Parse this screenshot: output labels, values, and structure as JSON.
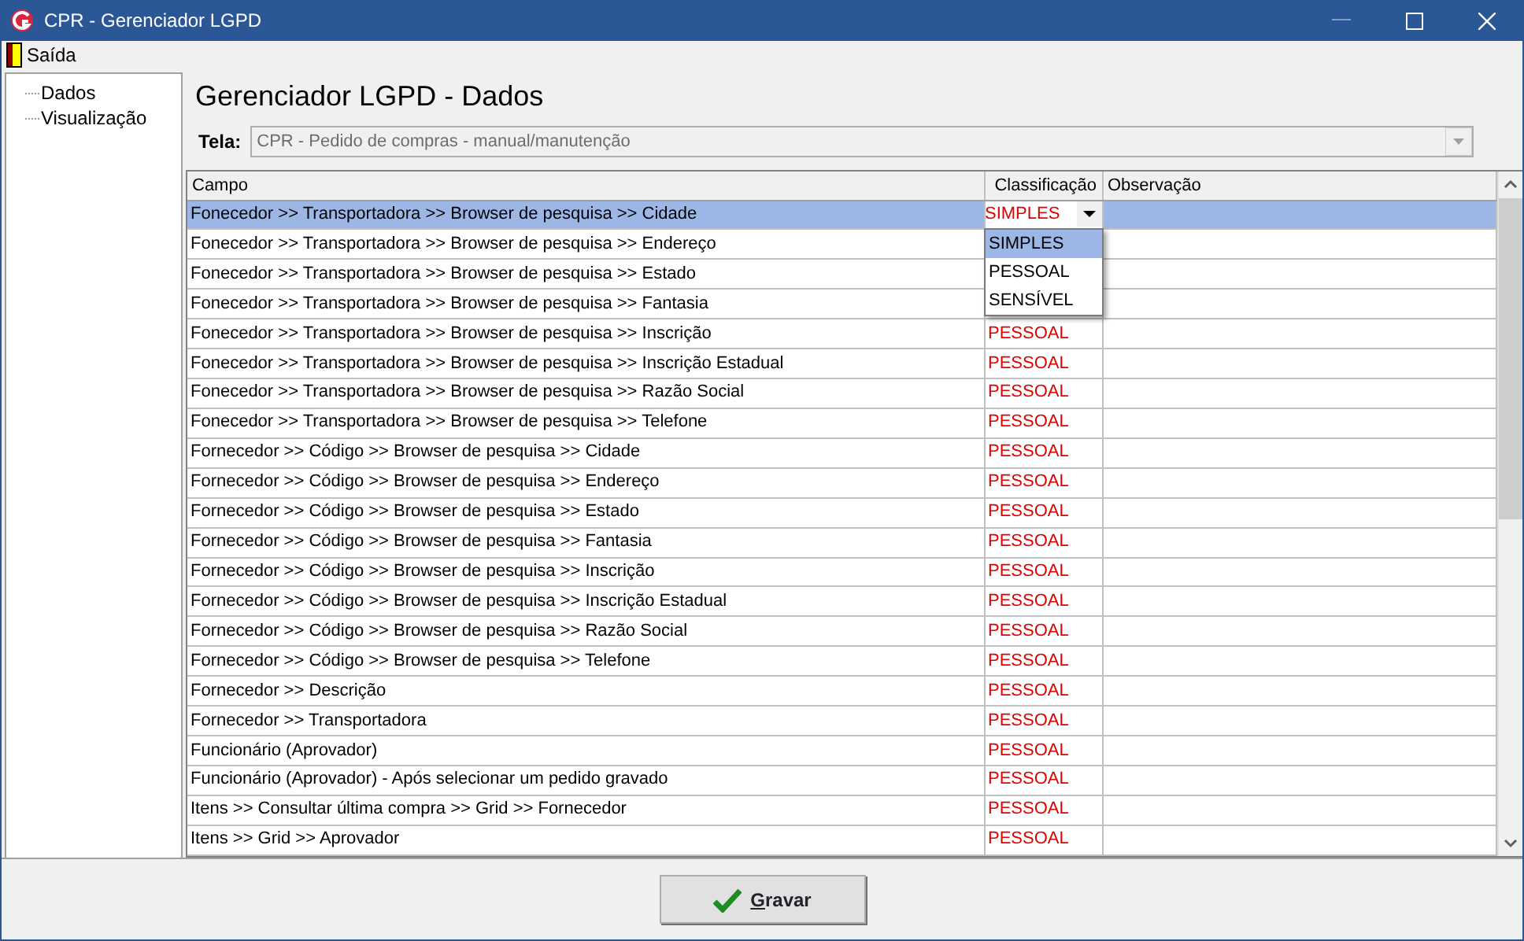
{
  "window": {
    "title": "CPR - Gerenciador LGPD"
  },
  "menu": [
    {
      "label": "Saída"
    }
  ],
  "tree": {
    "items": [
      {
        "label": "Dados",
        "selected": false
      },
      {
        "label": "Visualização",
        "selected": false
      }
    ]
  },
  "heading": "Gerenciador LGPD - Dados",
  "screen_field": {
    "label": "Tela:",
    "value": "CPR - Pedido de compras - manual/manutenção",
    "disabled": true
  },
  "table": {
    "columns": [
      "Campo",
      "Classificação",
      "Observação"
    ],
    "rows": [
      {
        "campo": "Fonecedor >> Transportadora >> Browser de pesquisa >> Cidade",
        "classificacao": "SIMPLES",
        "selected": true,
        "editing": true
      },
      {
        "campo": "Fonecedor >> Transportadora >> Browser de pesquisa >> Endereço",
        "selected": false
      },
      {
        "campo": "Fonecedor >> Transportadora >> Browser de pesquisa >> Estado",
        "selected": false
      },
      {
        "campo": "Fonecedor >> Transportadora >> Browser de pesquisa >> Fantasia",
        "selected": false
      },
      {
        "campo": "Fonecedor >> Transportadora >> Browser de pesquisa >> Inscrição",
        "classificacao": "PESSOAL",
        "selected": false
      },
      {
        "campo": "Fonecedor >> Transportadora >> Browser de pesquisa >> Inscrição Estadual",
        "classificacao": "PESSOAL",
        "selected": false
      },
      {
        "campo": "Fonecedor >> Transportadora >> Browser de pesquisa >> Razão Social",
        "classificacao": "PESSOAL",
        "selected": false
      },
      {
        "campo": "Fonecedor >> Transportadora >> Browser de pesquisa >> Telefone",
        "classificacao": "PESSOAL",
        "selected": false
      },
      {
        "campo": "Fornecedor >> Código >> Browser de pesquisa >> Cidade",
        "classificacao": "PESSOAL",
        "selected": false
      },
      {
        "campo": "Fornecedor >> Código >> Browser de pesquisa >> Endereço",
        "classificacao": "PESSOAL",
        "selected": false
      },
      {
        "campo": "Fornecedor >> Código >> Browser de pesquisa >> Estado",
        "classificacao": "PESSOAL",
        "selected": false
      },
      {
        "campo": "Fornecedor >> Código >> Browser de pesquisa >> Fantasia",
        "classificacao": "PESSOAL",
        "selected": false
      },
      {
        "campo": "Fornecedor >> Código >> Browser de pesquisa >> Inscrição",
        "classificacao": "PESSOAL",
        "selected": false
      },
      {
        "campo": "Fornecedor >> Código >> Browser de pesquisa >> Inscrição Estadual",
        "classificacao": "PESSOAL",
        "selected": false
      },
      {
        "campo": "Fornecedor >> Código >> Browser de pesquisa >> Razão Social",
        "classificacao": "PESSOAL",
        "selected": false
      },
      {
        "campo": "Fornecedor >> Código >> Browser de pesquisa >> Telefone",
        "classificacao": "PESSOAL",
        "selected": false
      },
      {
        "campo": "Fornecedor >> Descrição",
        "classificacao": "PESSOAL",
        "selected": false
      },
      {
        "campo": "Fornecedor >> Transportadora",
        "classificacao": "PESSOAL",
        "selected": false
      },
      {
        "campo": "Funcionário (Aprovador)",
        "classificacao": "PESSOAL",
        "selected": false
      },
      {
        "campo": "Funcionário (Aprovador) -  Após selecionar um pedido gravado",
        "classificacao": "PESSOAL",
        "selected": false
      },
      {
        "campo": "Itens >> Consultar última compra >> Grid >> Fornecedor",
        "classificacao": "PESSOAL",
        "selected": false
      },
      {
        "campo": "Itens >> Grid >> Aprovador",
        "classificacao": "PESSOAL",
        "selected": false
      }
    ]
  },
  "dropdown": {
    "options": [
      {
        "label": "SIMPLES",
        "selected": true
      },
      {
        "label": "PESSOAL",
        "selected": false
      },
      {
        "label": "SENSÍVEL",
        "selected": false
      }
    ]
  },
  "buttons": [
    {
      "label": "Gravar"
    }
  ]
}
